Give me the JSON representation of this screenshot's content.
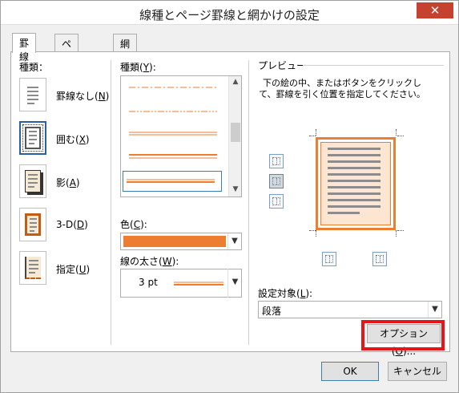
{
  "window": {
    "title": "線種とページ罫線と網かけの設定",
    "close_glyph": "✕"
  },
  "tabs": [
    {
      "label": "罫線",
      "active": true
    },
    {
      "label": "ページ罫線",
      "active": false
    },
    {
      "label": "網かけ",
      "active": false
    }
  ],
  "setting": {
    "heading": "種類：",
    "items": [
      {
        "label_main": "罫線なし(",
        "key": "N",
        "label_end": ")",
        "selected": false
      },
      {
        "label_main": "囲む(",
        "key": "X",
        "label_end": ")",
        "selected": true
      },
      {
        "label_main": "影(",
        "key": "A",
        "label_end": ")",
        "selected": false
      },
      {
        "label_main": "3-D(",
        "key": "D",
        "label_end": ")",
        "selected": false
      },
      {
        "label_main": "指定(",
        "key": "U",
        "label_end": ")",
        "selected": false
      }
    ]
  },
  "style": {
    "heading_main": "種類(",
    "heading_key": "Y",
    "heading_end": "):",
    "items": [
      "dash-dot-line",
      "dash-dot-dot-line",
      "double-thin-line",
      "thick-thin-double-line",
      "thin-thick-double-line"
    ],
    "selected_index": 4
  },
  "color": {
    "heading_main": "色(",
    "heading_key": "C",
    "heading_end": "):",
    "value": "#ed7d31"
  },
  "width": {
    "heading_main": "線の太さ(",
    "heading_key": "W",
    "heading_end": "):",
    "value": "3 pt"
  },
  "preview": {
    "heading": "プレビュー",
    "hint": "下の絵の中、またはボタンを使用して、罫線を引く位置を指定してください。",
    "hint_display": "下の絵の中、またはボタンをクリックして、罫線を引く位置を指定してください。"
  },
  "apply_to": {
    "heading_main": "設定対象(",
    "heading_key": "L",
    "heading_end": "):",
    "value": "段落"
  },
  "buttons": {
    "options_main": "オプション(",
    "options_key": "O",
    "options_end": ")...",
    "ok": "OK",
    "cancel": "キャンセル"
  },
  "colors": {
    "accent": "#ed7d31",
    "highlight": "#e8141a"
  },
  "icons": {
    "close": "close-icon",
    "dropdown": "chevron-down-icon",
    "scroll_up": "chevron-up-icon",
    "scroll_down": "chevron-down-icon"
  }
}
